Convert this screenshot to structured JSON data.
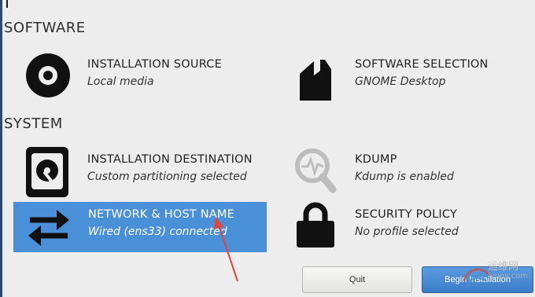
{
  "sections": {
    "software": "SOFTWARE",
    "system": "SYSTEM"
  },
  "spokes": {
    "installation_source": {
      "title": "INSTALLATION SOURCE",
      "status": "Local media",
      "icon": "disc-icon"
    },
    "software_selection": {
      "title": "SOFTWARE SELECTION",
      "status": "GNOME Desktop",
      "icon": "package-icon"
    },
    "installation_destination": {
      "title": "INSTALLATION DESTINATION",
      "status": "Custom partitioning selected",
      "icon": "hard-drive-icon"
    },
    "kdump": {
      "title": "KDUMP",
      "status": "Kdump is enabled",
      "icon": "magnifier-icon"
    },
    "network": {
      "title": "NETWORK & HOST NAME",
      "status": "Wired (ens33) connected",
      "icon": "network-arrows-icon",
      "selected": true
    },
    "security_policy": {
      "title": "SECURITY POLICY",
      "status": "No profile selected",
      "icon": "padlock-icon"
    }
  },
  "buttons": {
    "quit": "Quit",
    "begin": "Begin Installation"
  },
  "watermark": {
    "text1": "运维网",
    "text2": "iyunv.com"
  },
  "colors": {
    "background": "#ededed",
    "selected": "#4a90d9",
    "annotation_arrow": "#e0443b"
  }
}
